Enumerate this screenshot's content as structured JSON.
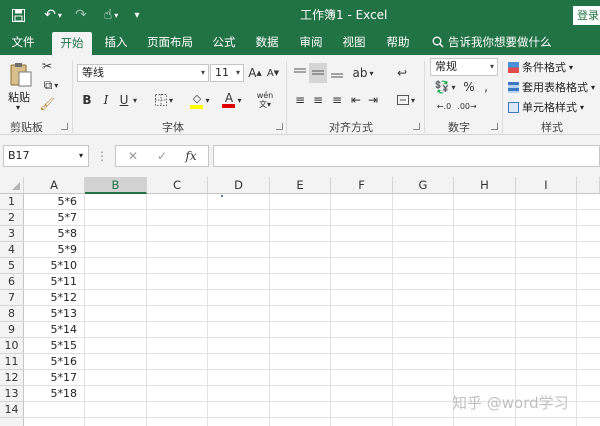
{
  "title_bar": {
    "title": "工作簿1  -  Excel",
    "login": "登录",
    "qat": [
      "save-icon",
      "undo-icon",
      "touch-mode-icon",
      "customize-icon"
    ]
  },
  "tabs": [
    {
      "label": "文件"
    },
    {
      "label": "开始",
      "active": true
    },
    {
      "label": "插入"
    },
    {
      "label": "页面布局"
    },
    {
      "label": "公式"
    },
    {
      "label": "数据"
    },
    {
      "label": "审阅"
    },
    {
      "label": "视图"
    },
    {
      "label": "帮助"
    },
    {
      "label": "告诉我你想要做什么"
    }
  ],
  "ribbon": {
    "clipboard": {
      "paste": "粘贴",
      "label": "剪贴板"
    },
    "font": {
      "name": "等线",
      "size": "11",
      "label": "字体",
      "grow": "A",
      "shrink": "A",
      "bold": "B",
      "italic": "I",
      "underline": "U",
      "font_color": "A",
      "phonetic": "wén"
    },
    "alignment": {
      "label": "对齐方式"
    },
    "number": {
      "format": "常规",
      "label": "数字",
      "percent": "%"
    },
    "styles": {
      "conditional": "条件格式",
      "table": "套用表格格式",
      "cell": "单元格样式",
      "label": "样式"
    }
  },
  "formula_bar": {
    "name_box": "B17",
    "fx": "fx",
    "value": ""
  },
  "columns": [
    "A",
    "B",
    "C",
    "D",
    "E",
    "F",
    "G",
    "H",
    "I"
  ],
  "selected_column": "B",
  "rows": [
    {
      "num": "1",
      "a": "5*6"
    },
    {
      "num": "2",
      "a": "5*7"
    },
    {
      "num": "3",
      "a": "5*8"
    },
    {
      "num": "4",
      "a": "5*9"
    },
    {
      "num": "5",
      "a": "5*10"
    },
    {
      "num": "6",
      "a": "5*11"
    },
    {
      "num": "7",
      "a": "5*12"
    },
    {
      "num": "8",
      "a": "5*13"
    },
    {
      "num": "9",
      "a": "5*14"
    },
    {
      "num": "10",
      "a": "5*15"
    },
    {
      "num": "11",
      "a": "5*16"
    },
    {
      "num": "12",
      "a": "5*17"
    },
    {
      "num": "13",
      "a": "5*18"
    },
    {
      "num": "14",
      "a": ""
    }
  ],
  "watermark": "知乎 @word学习",
  "colors": {
    "excel_green": "#217346",
    "ribbon_bg": "#f3f3f3"
  }
}
